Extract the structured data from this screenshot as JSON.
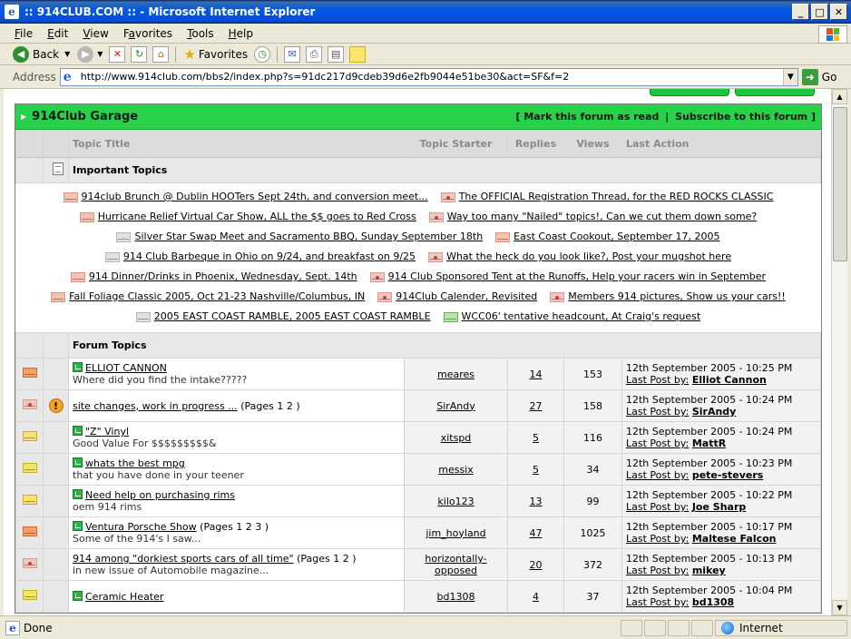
{
  "window": {
    "title": ":: 914CLUB.COM :: - Microsoft Internet Explorer"
  },
  "menu": [
    "File",
    "Edit",
    "View",
    "Favorites",
    "Tools",
    "Help"
  ],
  "menu_access_keys": [
    "F",
    "E",
    "V",
    "a",
    "T",
    "H"
  ],
  "toolbar": {
    "back": "Back",
    "favorites": "Favorites"
  },
  "address": {
    "label": "Address",
    "url": "http://www.914club.com/bbs2/index.php?s=91dc217d9cdeb39d6e2fb9044e51be30&act=SF&f=2",
    "go": "Go"
  },
  "forum": {
    "name": "914Club Garage",
    "mark_read": "Mark this forum as read",
    "subscribe": "Subscribe to this forum",
    "columns": {
      "title": "Topic Title",
      "starter": "Topic Starter",
      "replies": "Replies",
      "views": "Views",
      "last": "Last Action"
    },
    "important_label": "Important Topics",
    "forum_topics_label": "Forum Topics",
    "important": [
      [
        {
          "text": "914club Brunch @ Dublin HOOTers Sept 24th, and conversion meet...",
          "icon": "pink"
        },
        {
          "text": "The OFFICIAL Registration Thread, for the RED ROCKS CLASSIC",
          "icon": "pinkdot"
        }
      ],
      [
        {
          "text": "Hurricane Relief Virtual Car Show, ALL the $$ goes to Red Cross",
          "icon": "pink"
        },
        {
          "text": "Way too many \"Nailed\" topics!, Can we cut them down some?",
          "icon": "pinkdot"
        }
      ],
      [
        {
          "text": "Silver Star Swap Meet and Sacramento BBQ, Sunday September 18th",
          "icon": "gray"
        },
        {
          "text": "East Coast Cookout, September 17, 2005",
          "icon": "pink"
        }
      ],
      [
        {
          "text": "914 Club Barbeque in Ohio on 9/24, and breakfast on 9/25",
          "icon": "gray"
        },
        {
          "text": "What the heck do you look like?, Post your mugshot here",
          "icon": "pinkdot"
        }
      ],
      [
        {
          "text": "914 Dinner/Drinks in Phoenix, Wednesday, Sept. 14th",
          "icon": "pink"
        },
        {
          "text": "914 Club Sponsored Tent at the Runoffs, Help your racers win in September",
          "icon": "pinkdot"
        }
      ],
      [
        {
          "text": "Fall Foliage Classic 2005, Oct 21-23 Nashville/Columbus, IN",
          "icon": "pink"
        },
        {
          "text": "914Club Calender, Revisited",
          "icon": "pinkdot"
        },
        {
          "text": "Members 914 pictures, Show us your cars!!",
          "icon": "pinkdot"
        }
      ],
      [
        {
          "text": "2005 EAST COAST RAMBLE, 2005 EAST COAST RAMBLE",
          "icon": "gray"
        },
        {
          "text": " WCC06' tentative headcount, At Craig's request",
          "icon": "green"
        }
      ]
    ],
    "topics": [
      {
        "icon": "orange",
        "marker": "",
        "newdot": true,
        "title": "ELLIOT CANNON",
        "pages": "",
        "desc": "Where did you find the intake?????",
        "starter": "meares",
        "replies": "14",
        "views": "153",
        "date": "12th September 2005 - 10:25 PM",
        "last_by_label": "Last Post by:",
        "last_by": "Elliot Cannon"
      },
      {
        "icon": "pinkdot",
        "marker": "!",
        "newdot": false,
        "title": "site changes, work in progress ...",
        "pages": "(Pages 1 2 )",
        "desc": "",
        "starter": "SirAndy",
        "replies": "27",
        "views": "158",
        "date": "12th September 2005 - 10:24 PM",
        "last_by_label": "Last Post by:",
        "last_by": "SirAndy"
      },
      {
        "icon": "yellow",
        "marker": "",
        "newdot": true,
        "title": "\"Z\" Vinyl",
        "pages": "",
        "desc": "Good Value For $$$$$$$$$&",
        "starter": "xitspd",
        "replies": "5",
        "views": "116",
        "date": "12th September 2005 - 10:24 PM",
        "last_by_label": "Last Post by:",
        "last_by": "MattR"
      },
      {
        "icon": "yellow",
        "marker": "",
        "newdot": true,
        "title": "whats the best mpg",
        "pages": "",
        "desc": "that you have done in your teener",
        "starter": "messix",
        "replies": "5",
        "views": "34",
        "date": "12th September 2005 - 10:23 PM",
        "last_by_label": "Last Post by:",
        "last_by": "pete-stevers"
      },
      {
        "icon": "yellow",
        "marker": "",
        "newdot": true,
        "title": "Need help on purchasing rims",
        "pages": "",
        "desc": "oem 914 rims",
        "starter": "kilo123",
        "replies": "13",
        "views": "99",
        "date": "12th September 2005 - 10:22 PM",
        "last_by_label": "Last Post by:",
        "last_by": "Joe Sharp"
      },
      {
        "icon": "orange",
        "marker": "",
        "newdot": true,
        "title": "Ventura Porsche Show",
        "pages": "(Pages 1 2 3 )",
        "desc": "Some of the 914's I saw...",
        "starter": "jim_hoyland",
        "replies": "47",
        "views": "1025",
        "date": "12th September 2005 - 10:17 PM",
        "last_by_label": "Last Post by:",
        "last_by": "Maltese Falcon"
      },
      {
        "icon": "pinkdot",
        "marker": "",
        "newdot": false,
        "title": "914 among \"dorkiest sports cars of all time\"",
        "pages": "(Pages 1 2 )",
        "desc": "in new issue of Automobile magazine...",
        "starter": "horizontally-opposed",
        "replies": "20",
        "views": "372",
        "date": "12th September 2005 - 10:13 PM",
        "last_by_label": "Last Post by:",
        "last_by": "mikey"
      },
      {
        "icon": "yellow",
        "marker": "",
        "newdot": true,
        "title": "Ceramic Heater",
        "pages": "",
        "desc": "",
        "starter": "bd1308",
        "replies": "4",
        "views": "37",
        "date": "12th September 2005 - 10:04 PM",
        "last_by_label": "Last Post by:",
        "last_by": "bd1308"
      }
    ]
  },
  "status": {
    "text": "Done",
    "zone": "Internet"
  }
}
